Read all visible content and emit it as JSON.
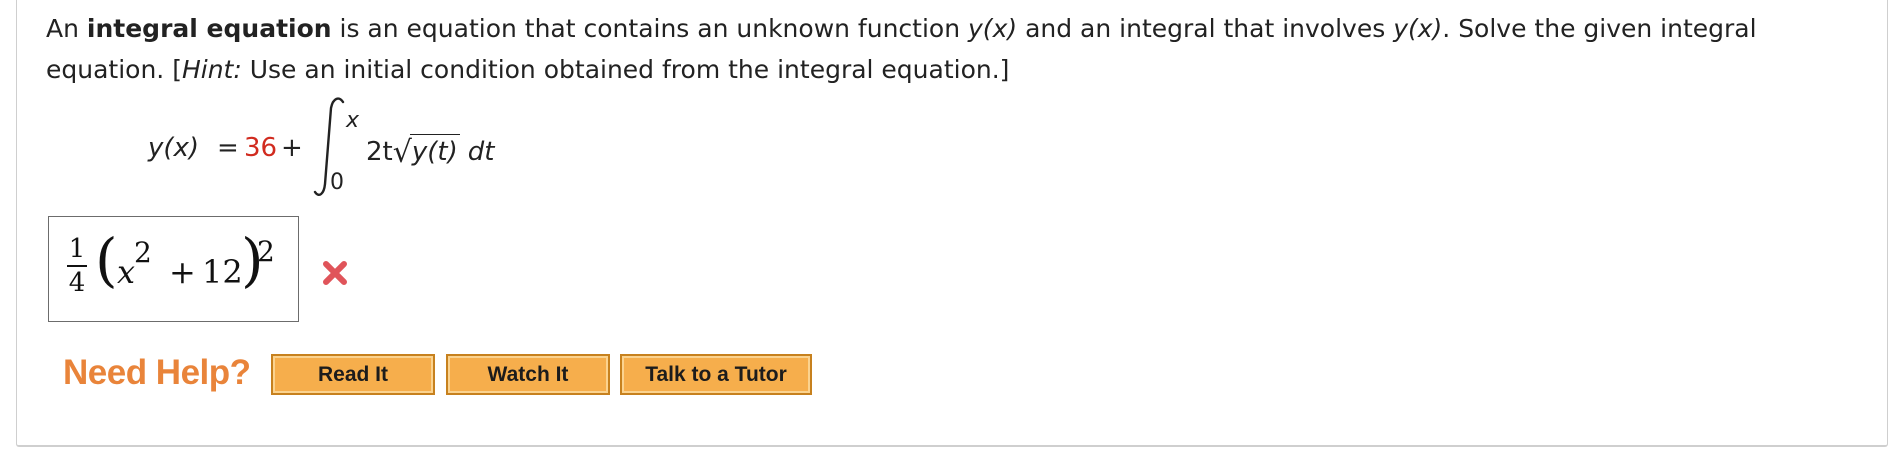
{
  "question": {
    "p1": "An ",
    "bold_term": "integral equation",
    "p2": " is an equation that contains an unknown function ",
    "fn1": "y(x)",
    "p3": " and an integral that involves ",
    "fn2": "y(x)",
    "p4": ". Solve the given integral equation. [",
    "hint_label": "Hint:",
    "hint_text": " Use an initial condition obtained from the integral equation.]"
  },
  "equation": {
    "lhs": "y(x)",
    "equals": "=",
    "constant": "36",
    "plus": "+",
    "upper_limit": "x",
    "lower_limit": "0",
    "coef": "2t",
    "radicand": "y(t)",
    "differential": "dt"
  },
  "answer": {
    "frac_num": "1",
    "frac_den": "4",
    "open_paren": "(",
    "var": "x",
    "exp1": "2",
    "plus": "+",
    "constant": "12",
    "close_paren": ")",
    "exp2": "2"
  },
  "status_color": "#e0545a",
  "help": {
    "label": "Need Help?",
    "buttons": [
      "Read It",
      "Watch It",
      "Talk to a Tutor"
    ]
  }
}
